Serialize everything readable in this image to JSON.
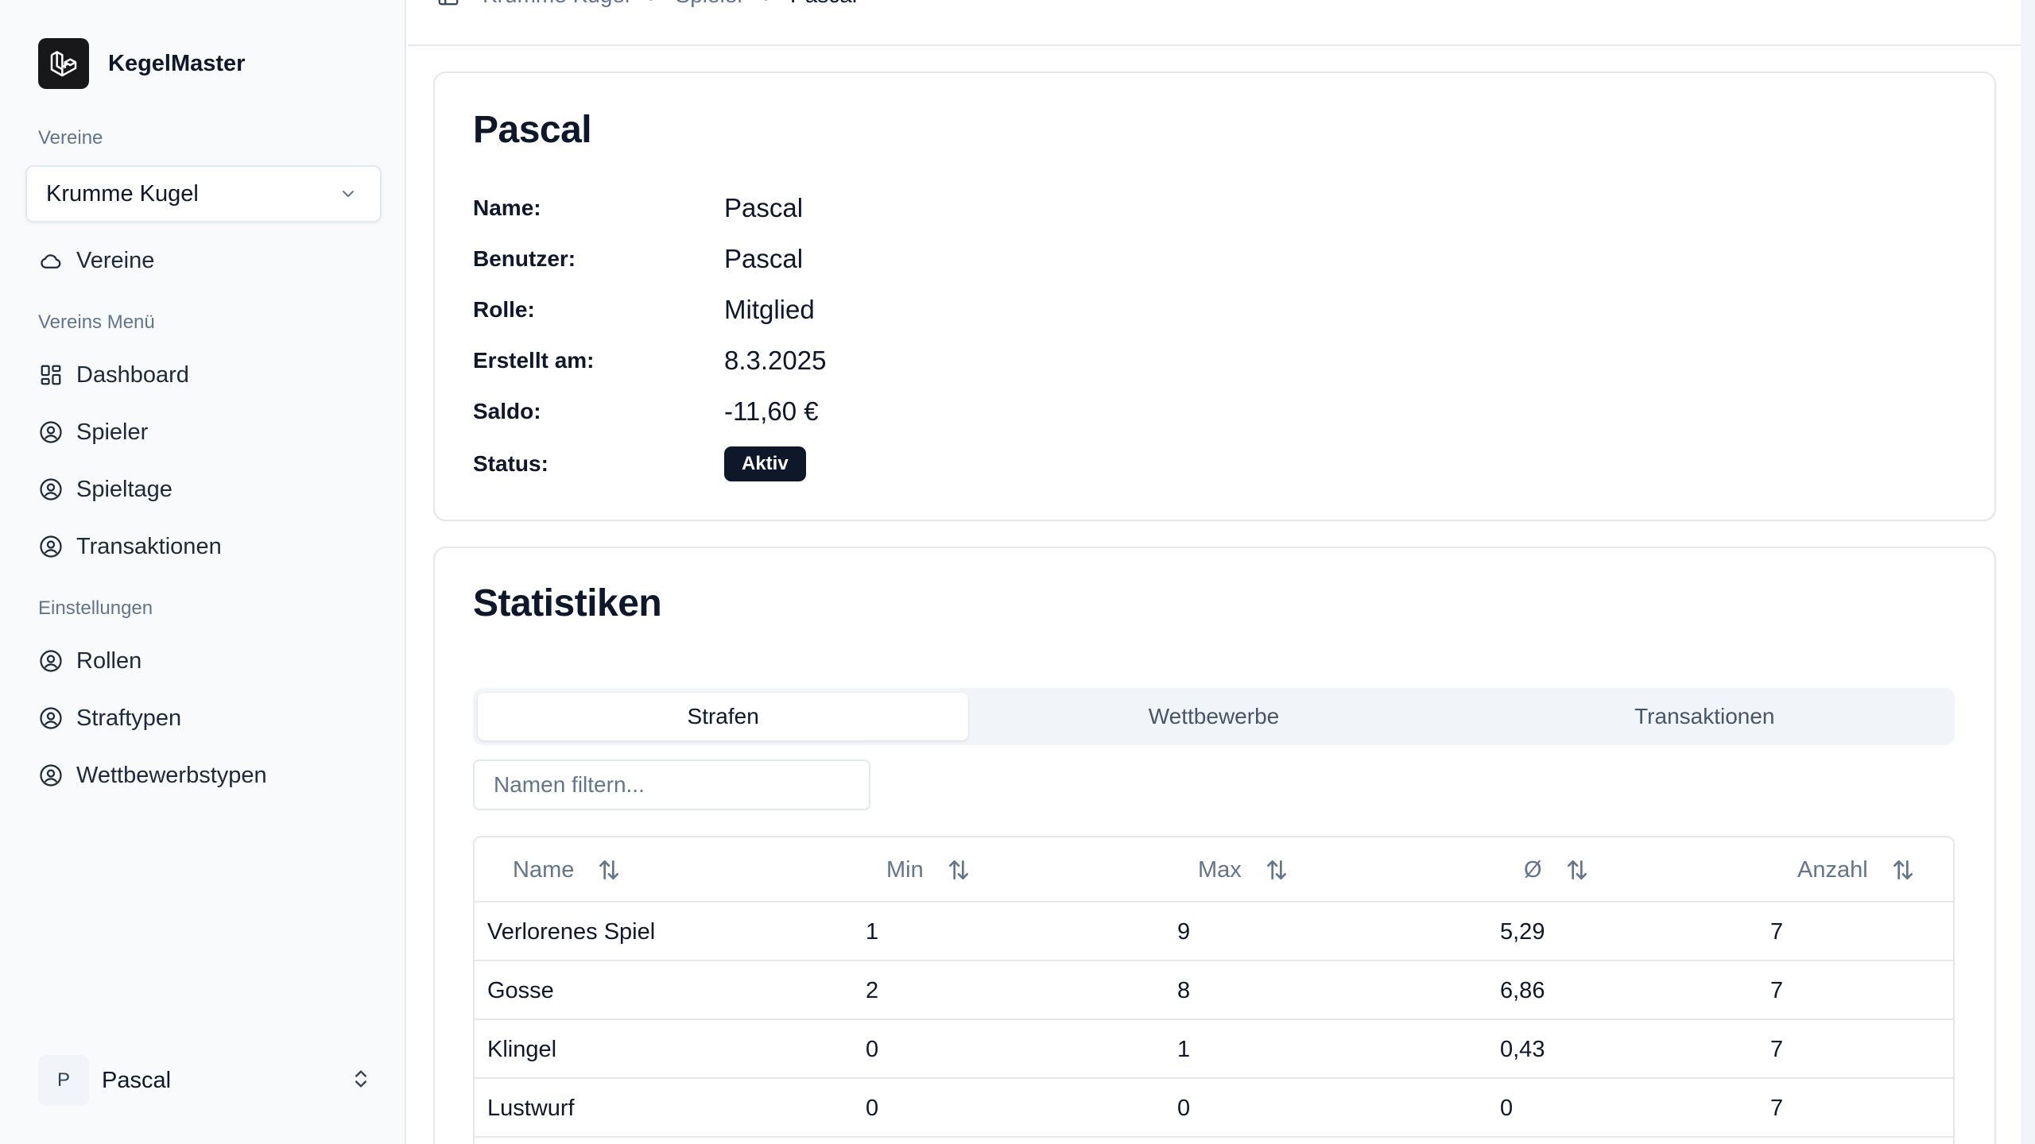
{
  "brand": {
    "name": "KegelMaster",
    "icon": "laravel-logo-icon"
  },
  "sidebar": {
    "clubs_label": "Vereine",
    "club_select_value": "Krumme Kugel",
    "clubs_link": "Vereine",
    "club_menu_label": "Vereins Menü",
    "club_menu": [
      {
        "label": "Dashboard",
        "icon": "dashboard-grid-icon"
      },
      {
        "label": "Spieler",
        "icon": "user-circle-icon"
      },
      {
        "label": "Spieltage",
        "icon": "user-circle-icon"
      },
      {
        "label": "Transaktionen",
        "icon": "user-circle-icon"
      }
    ],
    "settings_label": "Einstellungen",
    "settings_menu": [
      {
        "label": "Rollen",
        "icon": "user-circle-icon"
      },
      {
        "label": "Straftypen",
        "icon": "user-circle-icon"
      },
      {
        "label": "Wettbewerbstypen",
        "icon": "user-circle-icon"
      }
    ],
    "user": {
      "initial": "P",
      "name": "Pascal"
    }
  },
  "breadcrumb": {
    "items": [
      "Krumme Kugel",
      "Spieler"
    ],
    "current": "Pascal"
  },
  "profile": {
    "title": "Pascal",
    "fields": [
      {
        "label": "Name:",
        "value": "Pascal"
      },
      {
        "label": "Benutzer:",
        "value": "Pascal"
      },
      {
        "label": "Rolle:",
        "value": "Mitglied"
      },
      {
        "label": "Erstellt am:",
        "value": "8.3.2025"
      },
      {
        "label": "Saldo:",
        "value": "-11,60 €"
      }
    ],
    "status_label": "Status:",
    "status_value": "Aktiv"
  },
  "stats": {
    "title": "Statistiken",
    "tabs": [
      "Strafen",
      "Wettbewerbe",
      "Transaktionen"
    ],
    "active_tab": "Strafen",
    "filter_placeholder": "Namen filtern...",
    "columns": [
      "Name",
      "Min",
      "Max",
      "Ø",
      "Anzahl"
    ],
    "rows": [
      [
        "Verlorenes Spiel",
        "1",
        "9",
        "5,29",
        "7"
      ],
      [
        "Gosse",
        "2",
        "8",
        "6,86",
        "7"
      ],
      [
        "Klingel",
        "0",
        "1",
        "0,43",
        "7"
      ],
      [
        "Lustwurf",
        "0",
        "0",
        "0",
        "7"
      ]
    ]
  }
}
